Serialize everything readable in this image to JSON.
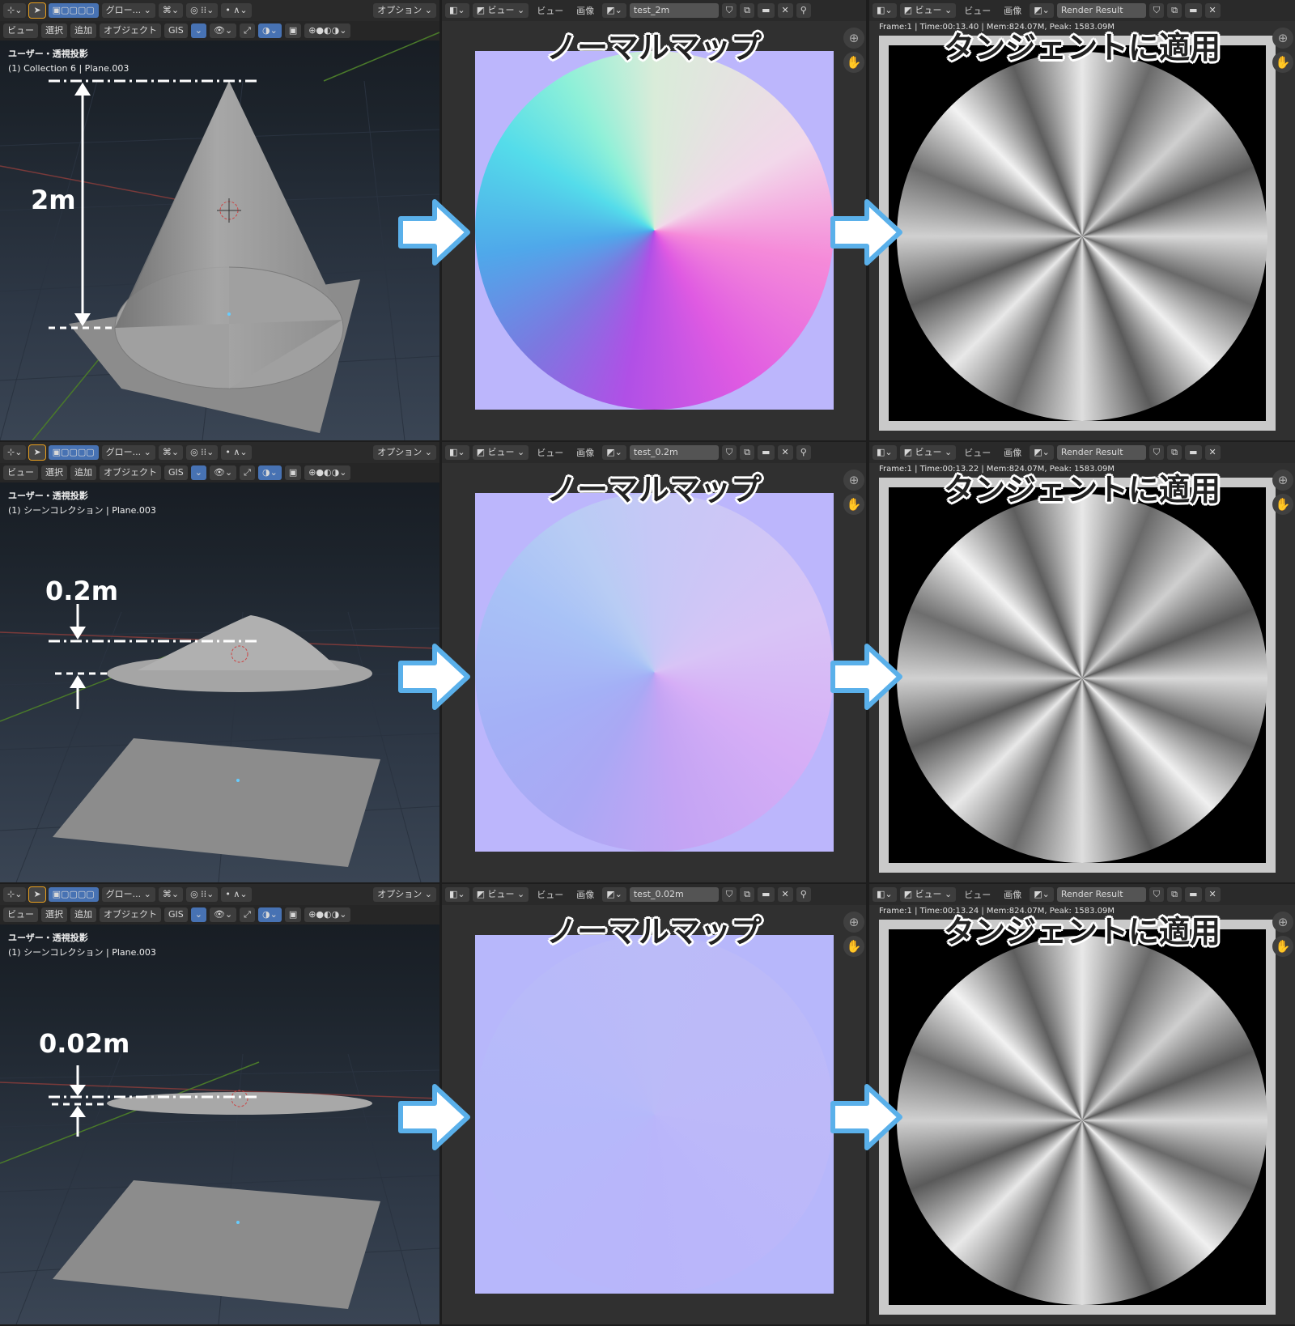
{
  "toolbar": {
    "transform_orientation": "グロー...",
    "options": "オプション",
    "view": "ビュー",
    "select": "選択",
    "add": "追加",
    "object": "オブジェクト",
    "gis": "GIS",
    "image": "画像",
    "render_result": "Render Result"
  },
  "headings": {
    "normal_map": "ノーマルマップ",
    "tangent_applied": "タンジェントに適用"
  },
  "rows": [
    {
      "viewport_mode": "ユーザー・透視投影",
      "collection": "(1) Collection 6 | Plane.003",
      "image_name": "test_2m",
      "dimension": "2m",
      "render_stats": "Frame:1 | Time:00:13.40 | Mem:824.07M, Peak: 1583.09M"
    },
    {
      "viewport_mode": "ユーザー・透視投影",
      "collection": "(1) シーンコレクション | Plane.003",
      "image_name": "test_0.2m",
      "dimension": "0.2m",
      "render_stats": "Frame:1 | Time:00:13.22 | Mem:824.07M, Peak: 1583.09M"
    },
    {
      "viewport_mode": "ユーザー・透視投影",
      "collection": "(1) シーンコレクション | Plane.003",
      "image_name": "test_0.02m",
      "dimension": "0.02m",
      "render_stats": "Frame:1 | Time:00:13.24 | Mem:824.07M, Peak: 1583.09M"
    }
  ],
  "icons": {
    "editor_type": "editor-type-icon",
    "select_box": "select-box-icon",
    "zoom": "zoom-icon",
    "hand": "hand-icon",
    "pin": "pin-icon",
    "close": "close-icon",
    "folder": "folder-icon",
    "shield": "fake-user-shield-icon",
    "duplicate": "duplicate-icon",
    "flow_arrow": "flow-arrow-icon"
  },
  "colors": {
    "accent": "#4772b3",
    "arrow_fill": "#ffffff",
    "arrow_stroke": "#5ab0ea",
    "flat_normal": "#b7b7fb"
  }
}
